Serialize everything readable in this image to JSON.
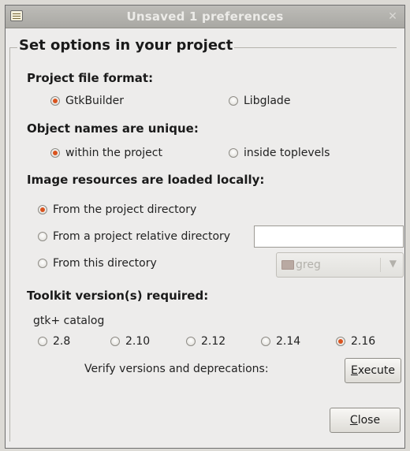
{
  "window": {
    "title": "Unsaved 1 preferences",
    "close_glyph": "✕"
  },
  "frame": {
    "legend": "Set options in your project"
  },
  "file_format": {
    "label": "Project file format:",
    "options": [
      {
        "label": "GtkBuilder",
        "checked": true
      },
      {
        "label": "Libglade",
        "checked": false
      }
    ]
  },
  "object_names": {
    "label": "Object names are unique:",
    "options": [
      {
        "label": "within the project",
        "checked": true
      },
      {
        "label": "inside toplevels",
        "checked": false
      }
    ]
  },
  "image_resources": {
    "label": "Image resources are loaded locally:",
    "options": [
      {
        "label": "From the project directory",
        "checked": true
      },
      {
        "label": "From a project relative directory",
        "checked": false
      },
      {
        "label": "From this directory",
        "checked": false
      }
    ],
    "relative_dir_value": "",
    "directory_combo": {
      "value": "greg",
      "arrow_glyph": "▼"
    }
  },
  "toolkit": {
    "label": "Toolkit version(s) required:",
    "catalog_label": "gtk+ catalog",
    "versions": [
      {
        "label": "2.8",
        "checked": false
      },
      {
        "label": "2.10",
        "checked": false
      },
      {
        "label": "2.12",
        "checked": false
      },
      {
        "label": "2.14",
        "checked": false
      },
      {
        "label": "2.16",
        "checked": true
      }
    ],
    "verify_label": "Verify versions and deprecations:",
    "execute_button": {
      "mnemonic": "E",
      "rest": "xecute"
    }
  },
  "close_button": {
    "mnemonic": "C",
    "rest": "lose"
  }
}
